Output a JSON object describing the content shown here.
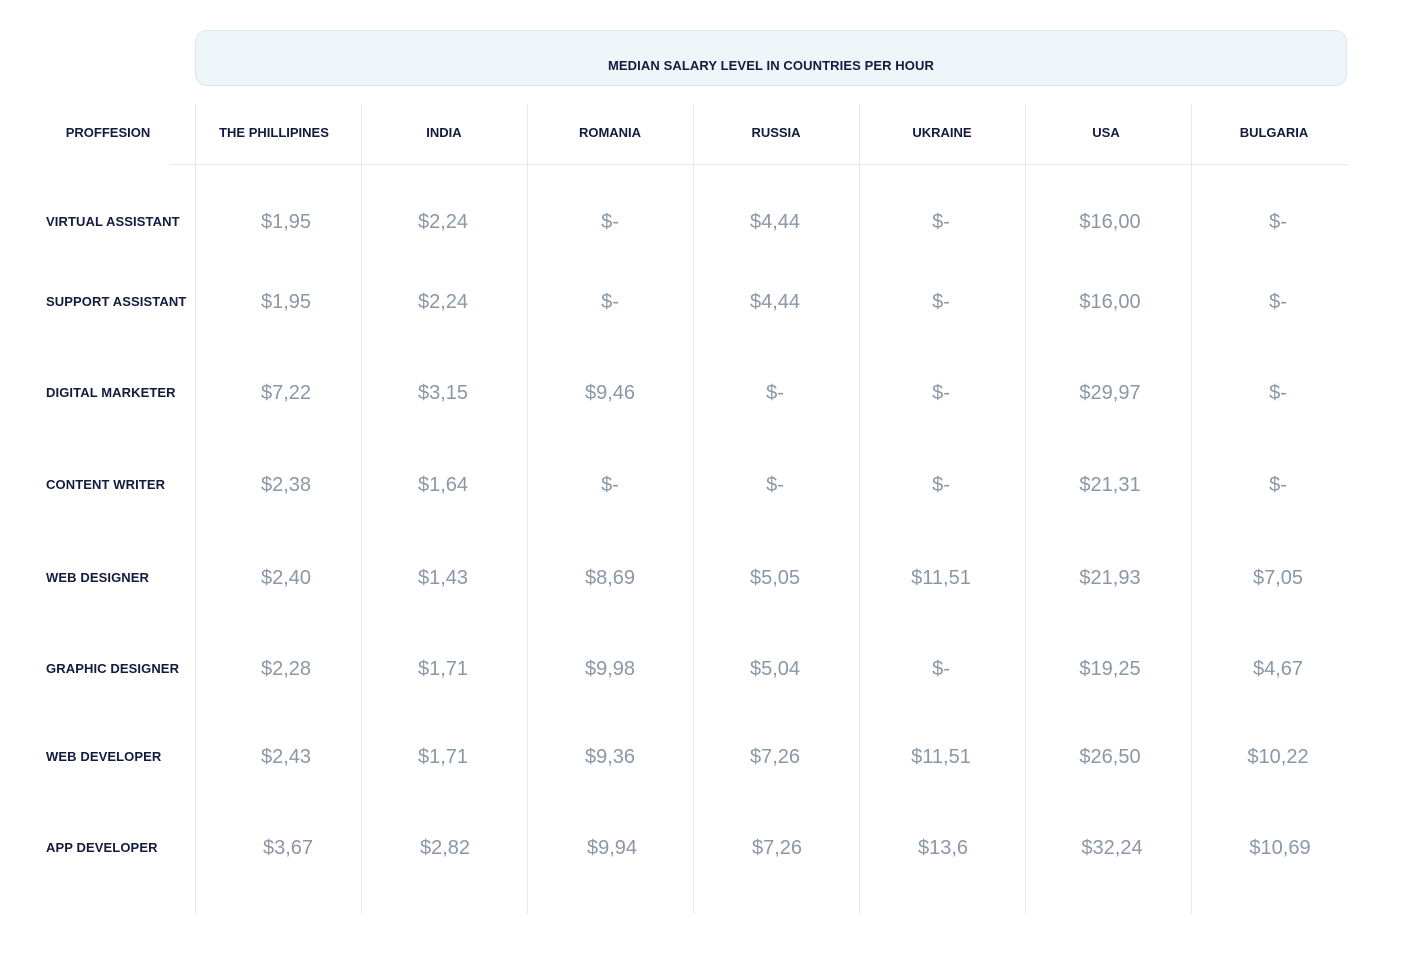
{
  "title": "MEDIAN SALARY LEVEL IN COUNTRIES PER HOUR",
  "table": {
    "corner_header": "PROFFESION",
    "columns": [
      "THE PHILLIPINES",
      "INDIA",
      "ROMANIA",
      "RUSSIA",
      "UKRAINE",
      "USA",
      "BULGARIA"
    ],
    "rows": [
      {
        "profession": "VIRTUAL ASSISTANT",
        "values": [
          "$1,95",
          "$2,24",
          "$-",
          "$4,44",
          "$-",
          "$16,00",
          "$-"
        ]
      },
      {
        "profession": "SUPPORT ASSISTANT",
        "values": [
          "$1,95",
          "$2,24",
          "$-",
          "$4,44",
          "$-",
          "$16,00",
          "$-"
        ]
      },
      {
        "profession": "DIGITAL MARKETER",
        "values": [
          "$7,22",
          "$3,15",
          "$9,46",
          "$-",
          "$-",
          "$29,97",
          "$-"
        ]
      },
      {
        "profession": "CONTENT WRITER",
        "values": [
          "$2,38",
          "$1,64",
          "$-",
          "$-",
          "$-",
          "$21,31",
          "$-"
        ]
      },
      {
        "profession": "WEB DESIGNER",
        "values": [
          "$2,40",
          "$1,43",
          "$8,69",
          "$5,05",
          "$11,51",
          "$21,93",
          "$7,05"
        ]
      },
      {
        "profession": "GRAPHIC DESIGNER",
        "values": [
          "$2,28",
          "$1,71",
          "$9,98",
          "$5,04",
          "$-",
          "$19,25",
          "$4,67"
        ]
      },
      {
        "profession": "WEB DEVELOPER",
        "values": [
          "$2,43",
          "$1,71",
          "$9,36",
          "$7,26",
          "$11,51",
          "$26,50",
          "$10,22"
        ]
      },
      {
        "profession": "APP DEVELOPER",
        "values": [
          "$3,67",
          "$2,82",
          "$9,94",
          "$7,26",
          "$13,6",
          "$32,24",
          "$10,69"
        ]
      }
    ]
  },
  "colors": {
    "heading_text": "#141b3f",
    "value_text": "#8a97a6",
    "banner_bg": "#eef6fa",
    "grid_line": "#e3e9ef"
  }
}
